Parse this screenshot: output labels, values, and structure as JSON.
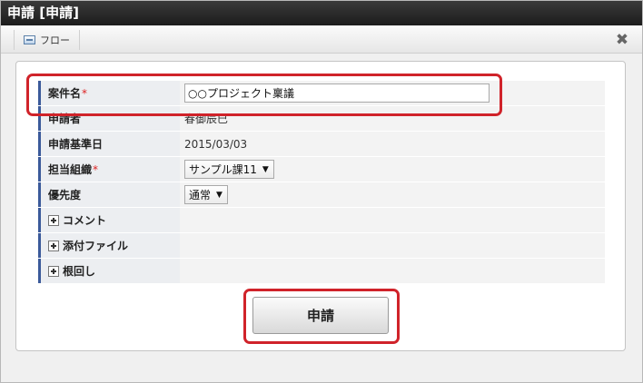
{
  "window": {
    "title": "申請 [申請]"
  },
  "toolbar": {
    "flow_label": "フロー",
    "close_glyph": "✖"
  },
  "form": {
    "rows": [
      {
        "label": "案件名",
        "required": "*",
        "value": "○○プロジェクト稟議"
      },
      {
        "label": "申請者",
        "value": "春御辰巳"
      },
      {
        "label": "申請基準日",
        "value": "2015/03/03"
      },
      {
        "label": "担当組織",
        "required": "*",
        "value": "サンプル課11"
      },
      {
        "label": "優先度",
        "value": "通常"
      }
    ],
    "sections": [
      {
        "label": "コメント"
      },
      {
        "label": "添付ファイル"
      },
      {
        "label": "根回し"
      }
    ]
  },
  "submit": {
    "label": "申請"
  },
  "colors": {
    "highlight": "#d0232a",
    "label_accent": "#3b5a9a",
    "required": "#dd2222"
  },
  "icons": [
    "flow-icon",
    "close-icon",
    "dropdown-arrow-icon",
    "expand-plus-icon"
  ]
}
